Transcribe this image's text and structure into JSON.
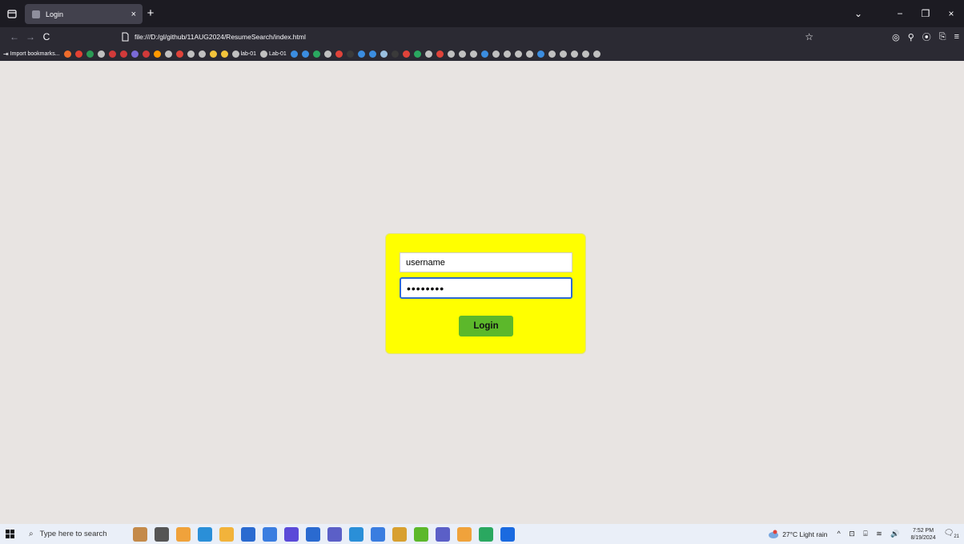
{
  "browser": {
    "tab": {
      "title": "Login",
      "close": "×"
    },
    "new_tab": "+",
    "window_controls": {
      "tab_list": "⌄",
      "minimize": "−",
      "restore": "❐",
      "close": "×"
    },
    "nav": {
      "back": "←",
      "forward": "→",
      "reload": "C"
    },
    "url": "file:///D:/gl/github/11AUG2024/ResumeSearch/index.html",
    "bookmark_star": "☆",
    "toolbar_right": [
      "◎",
      "⚲",
      "⦿",
      "⎘",
      "≡"
    ]
  },
  "bookmarks": {
    "import_label": "Import bookmarks...",
    "items": [
      {
        "color": "#f06d2b",
        "label": ""
      },
      {
        "color": "#e34133",
        "label": ""
      },
      {
        "color": "#2b9a55",
        "label": ""
      },
      {
        "color": "#c0c0c0",
        "label": ""
      },
      {
        "color": "#d13a3a",
        "label": ""
      },
      {
        "color": "#d13a3a",
        "label": ""
      },
      {
        "color": "#7a6ad8",
        "label": ""
      },
      {
        "color": "#d13a3a",
        "label": ""
      },
      {
        "color": "#ff9a00",
        "label": ""
      },
      {
        "color": "#c0c0c0",
        "label": ""
      },
      {
        "color": "#e0433a",
        "label": ""
      },
      {
        "color": "#c0c0c0",
        "label": ""
      },
      {
        "color": "#c0c0c0",
        "label": ""
      },
      {
        "color": "#f2c33b",
        "label": ""
      },
      {
        "color": "#f2c33b",
        "label": ""
      },
      {
        "color": "#c0c0c0",
        "label": "lab-01"
      },
      {
        "color": "#c0c0c0",
        "label": "Lab-01"
      },
      {
        "color": "#3b8de0",
        "label": ""
      },
      {
        "color": "#3b8de0",
        "label": ""
      },
      {
        "color": "#2aa860",
        "label": ""
      },
      {
        "color": "#c0c0c0",
        "label": ""
      },
      {
        "color": "#e0433a",
        "label": ""
      },
      {
        "color": "#3a3a3a",
        "label": ""
      },
      {
        "color": "#3b8de0",
        "label": ""
      },
      {
        "color": "#3b8de0",
        "label": ""
      },
      {
        "color": "#9ac0e0",
        "label": ""
      },
      {
        "color": "#3a3a3a",
        "label": ""
      },
      {
        "color": "#e0433a",
        "label": ""
      },
      {
        "color": "#2aa860",
        "label": ""
      },
      {
        "color": "#c0c0c0",
        "label": ""
      },
      {
        "color": "#e0433a",
        "label": ""
      },
      {
        "color": "#c0c0c0",
        "label": ""
      },
      {
        "color": "#c0c0c0",
        "label": ""
      },
      {
        "color": "#c0c0c0",
        "label": ""
      },
      {
        "color": "#3b8de0",
        "label": ""
      },
      {
        "color": "#c0c0c0",
        "label": ""
      },
      {
        "color": "#c0c0c0",
        "label": ""
      },
      {
        "color": "#c0c0c0",
        "label": ""
      },
      {
        "color": "#c0c0c0",
        "label": ""
      },
      {
        "color": "#3b8de0",
        "label": ""
      },
      {
        "color": "#c0c0c0",
        "label": ""
      },
      {
        "color": "#c0c0c0",
        "label": ""
      },
      {
        "color": "#c0c0c0",
        "label": ""
      },
      {
        "color": "#c0c0c0",
        "label": ""
      },
      {
        "color": "#c0c0c0",
        "label": ""
      }
    ]
  },
  "login": {
    "username_value": "username",
    "password_value": "password",
    "button_label": "Login",
    "box_color": "#ffff00",
    "button_color": "#5cb82b"
  },
  "taskbar": {
    "search_placeholder": "Type here to search",
    "icons": [
      "#c48a4a",
      "#555555",
      "#f0a23b",
      "#2a8fd8",
      "#f2b33b",
      "#2a6ad0",
      "#3a7de0",
      "#5b4ad8",
      "#2a6ad0",
      "#5b5fc7",
      "#2a8fd8",
      "#3a7de0",
      "#d8a030",
      "#5cb82b",
      "#5b5fc7",
      "#f0a23b",
      "#2aa860",
      "#1a6ae0"
    ],
    "weather": "27°C  Light rain",
    "sys_icons": "^ ⊡ ⌸ ≋ 🔊",
    "time": "7:52 PM",
    "date": "8/19/2024",
    "notif_count": "21"
  }
}
